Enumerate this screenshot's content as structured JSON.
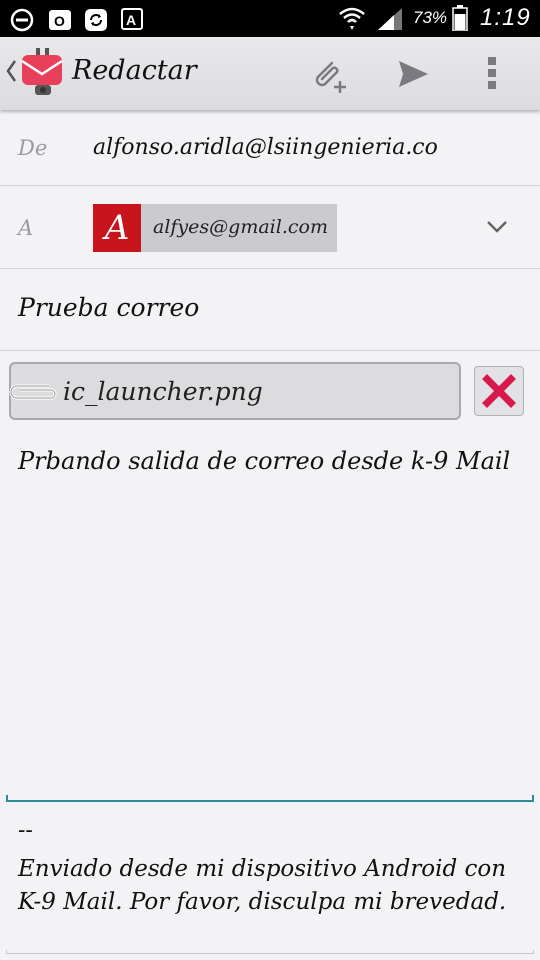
{
  "status_bar": {
    "icons": [
      "do-not-disturb-icon",
      "outlook-icon",
      "sync-icon",
      "font-icon",
      "wifi-icon",
      "signal-icon",
      "battery-icon"
    ],
    "battery": "73%",
    "clock": "1:19"
  },
  "action_bar": {
    "title": "Redactar",
    "icons": [
      "back-chevron-icon",
      "k9-mail-logo-icon",
      "attach-icon",
      "send-icon",
      "overflow-menu-icon"
    ],
    "accent_color": "#e8405b"
  },
  "compose": {
    "from_label": "De",
    "from_value": "alfonso.aridla@lsiingenieria.co",
    "to_label": "A",
    "to_chip": {
      "avatar_letter": "A",
      "email": "alfyes@gmail.com",
      "avatar_color": "#c8141c"
    },
    "subject": "Prueba correo",
    "attachment": {
      "filename": "ic_launcher.png",
      "remove_color": "#d7194c"
    },
    "body": "Prbando salida de correo desde k-9 Mail",
    "signature_separator": "--",
    "signature": "Enviado desde mi dispositivo Android con K-9 Mail. Por favor, disculpa mi brevedad."
  }
}
